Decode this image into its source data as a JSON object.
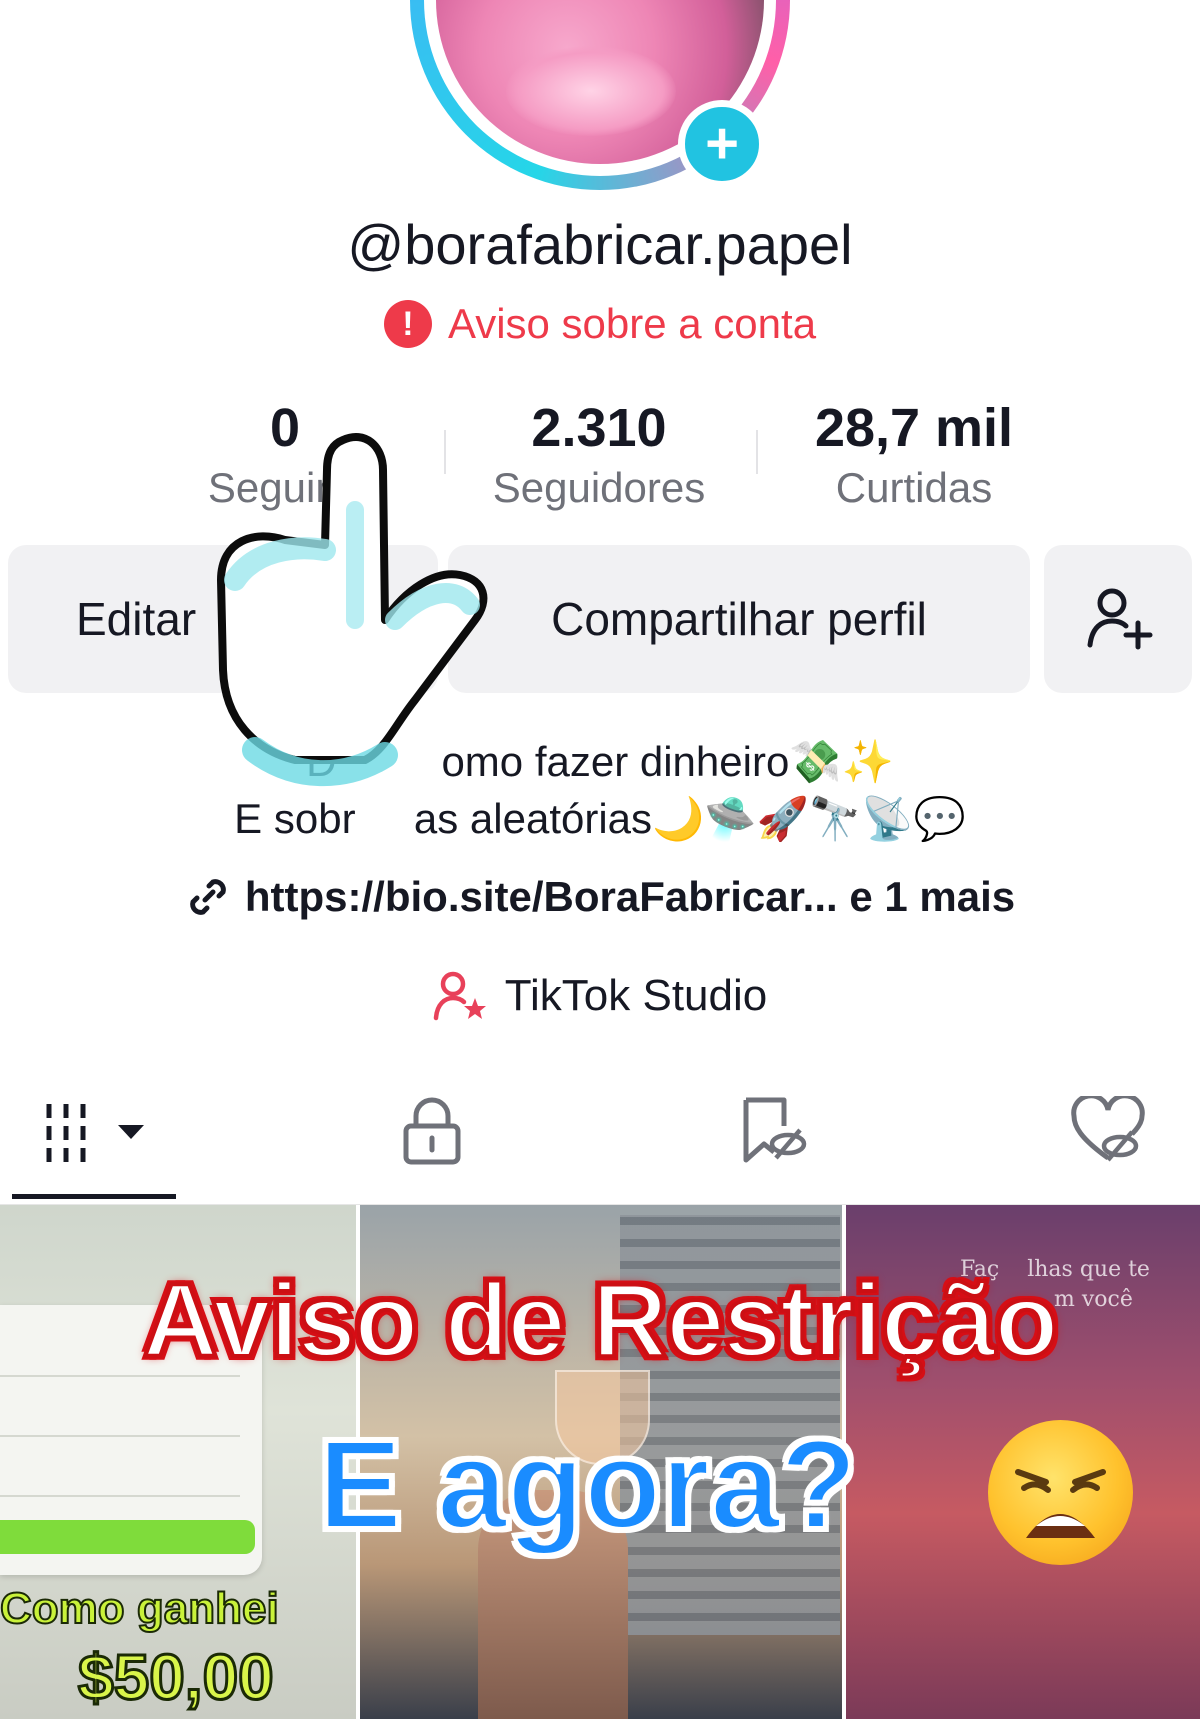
{
  "profile": {
    "username": "@borafabricar.papel",
    "warning": "Aviso sobre a conta"
  },
  "stats": [
    {
      "value": "0",
      "label": "Seguind"
    },
    {
      "value": "2.310",
      "label": "Seguidores"
    },
    {
      "value": "28,7 mil",
      "label": "Curtidas"
    }
  ],
  "actions": {
    "edit": "Editar",
    "share": "Compartilhar perfil"
  },
  "bio": {
    "line1": "D         omo fazer dinheiro💸✨",
    "line2": "E sobr     as aleatórias🌙🛸🚀🔭📡💬",
    "link": "https://bio.site/BoraFabricar... e 1 mais",
    "studio": "TikTok Studio"
  },
  "tabs": [
    "videos-grid",
    "private",
    "reposts",
    "liked"
  ],
  "thumbnails": {
    "first_caption_line1": "Como ganhei",
    "first_caption_line2": "$50,00",
    "third_text": "Faç    lhas que te\n           m você"
  },
  "overlay": {
    "headline": "Aviso de Restrição",
    "subhead": "E agora?"
  },
  "colors": {
    "warning": "#ee3a4a",
    "accent_cyan": "#21c3e1",
    "headline_red": "#cc0f14",
    "subhead_blue": "#1a8cff"
  }
}
